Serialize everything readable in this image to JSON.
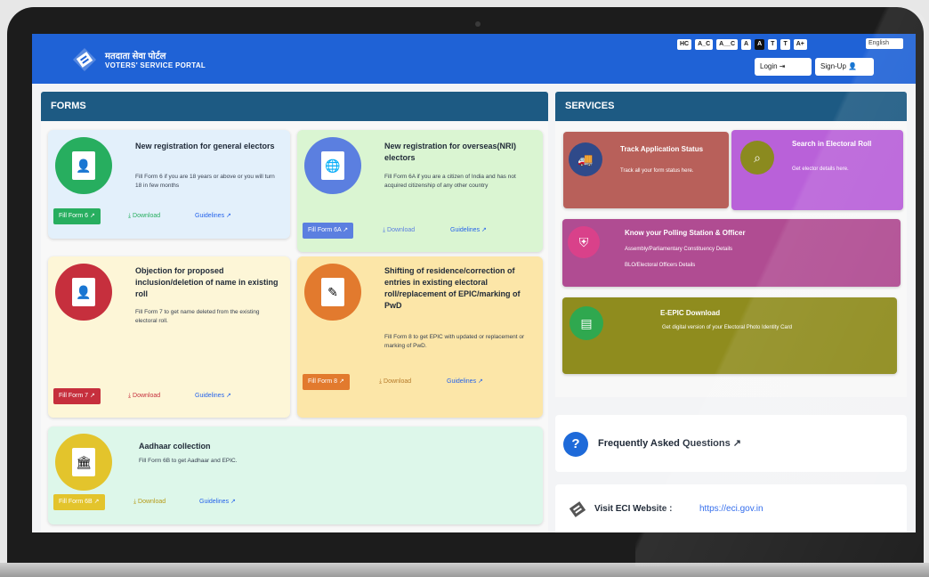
{
  "header": {
    "brand_hindi": "मतदाता सेवा पोर्टल",
    "brand_en": "VOTERS' SERVICE PORTAL",
    "a11y_buttons": [
      "HC",
      "A_C",
      "A__C",
      "A",
      "A",
      "T",
      "T",
      "A+"
    ],
    "language": "English",
    "login_label": "Login ⇥",
    "signup_label": "Sign-Up 👤"
  },
  "forms": {
    "section_title": "FORMS",
    "cards": [
      {
        "title": "New registration for general electors",
        "desc": "Fill Form 6 if you are 18 years or above or you will turn 18 in few months",
        "form_btn": "Fill Form 6 ↗",
        "download": "⤓ Download",
        "guidelines": "Guidelines ↗",
        "doc_label": "FORM 6",
        "color": "#27ae5f"
      },
      {
        "title": "New registration for overseas(NRI) electors",
        "desc": "Fill Form 6A if you are a citizen of India and has not acquired citizenship of any other country",
        "form_btn": "Fill Form 6A ↗",
        "download": "⤓ Download",
        "guidelines": "Guidelines ↗",
        "doc_label": "FORM 6A",
        "color": "#5b7fe0"
      },
      {
        "title": "Objection for proposed inclusion/deletion of name in existing roll",
        "desc": "Fill Form 7 to get name deleted from the existing electoral roll.",
        "form_btn": "Fill Form 7 ↗",
        "download": "⤓ Download",
        "guidelines": "Guidelines ↗",
        "doc_label": "FORM 7",
        "color": "#c62f3d"
      },
      {
        "title": "Shifting of residence/correction of entries in existing electoral roll/replacement of EPIC/marking of PwD",
        "desc": "Fill Form 8 to get EPIC with updated or replacement or marking of PwD.",
        "form_btn": "Fill Form 8 ↗",
        "download": "⤓ Download",
        "guidelines": "Guidelines ↗",
        "doc_label": "FORM 8",
        "color": "#e27a2e"
      },
      {
        "title": "Aadhaar collection",
        "desc": "Fill Form 6B to get Aadhaar and EPIC.",
        "form_btn": "Fill Form 6B ↗",
        "download": "⤓ Download",
        "guidelines": "Guidelines ↗",
        "doc_label": "FORM 6B",
        "color": "#e3c42c"
      }
    ]
  },
  "services": {
    "section_title": "SERVICES",
    "items": [
      {
        "title": "Track Application Status",
        "desc": "Track all your form status here."
      },
      {
        "title": "Search in Electoral Roll",
        "desc": "Get elector details here."
      },
      {
        "title": "Know your Polling Station & Officer",
        "desc": "Assembly/Parliamentary Constituency Details",
        "desc2": "BLO/Electoral Officers Details"
      },
      {
        "title": "E-EPIC Download",
        "desc": "Get digital version of your Electoral Photo Identity Card"
      }
    ],
    "faq": "Frequently Asked Questions ↗",
    "eci_label": "Visit ECI Website :",
    "eci_link": "https://eci.gov.in"
  }
}
